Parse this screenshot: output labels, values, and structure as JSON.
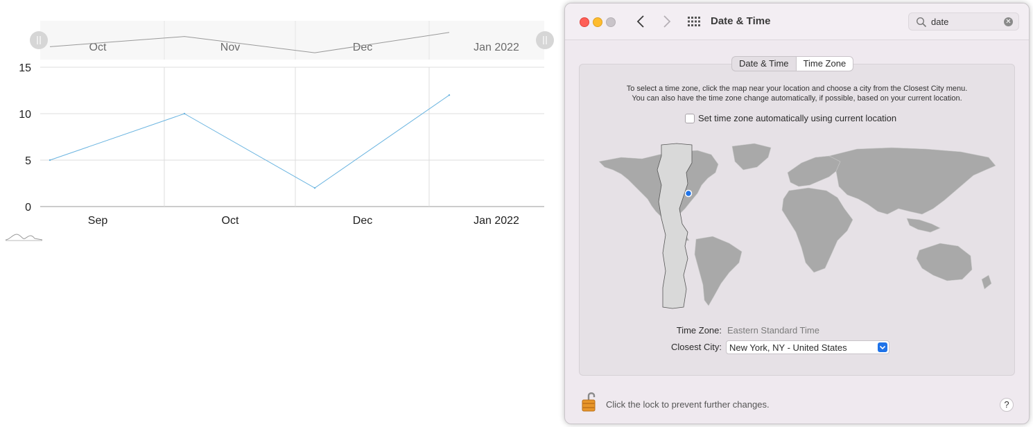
{
  "chart_data": {
    "type": "line",
    "x": [
      "Sep",
      "Oct",
      "Nov",
      "Dec",
      "Jan 2022"
    ],
    "values": [
      5,
      10,
      2,
      12
    ],
    "x_tick_labels": [
      "Sep",
      "Oct",
      "Dec",
      "Jan 2022"
    ],
    "navigator_tick_labels": [
      "Oct",
      "Nov",
      "Dec",
      "Jan 2022"
    ],
    "y_ticks": [
      "0",
      "5",
      "10",
      "15"
    ],
    "ylim": [
      0,
      15
    ],
    "grid": true,
    "line_color": "#6ab4e0"
  },
  "window": {
    "title": "Date & Time",
    "search_value": "date",
    "tabs": [
      {
        "label": "Date & Time",
        "selected": false
      },
      {
        "label": "Time Zone",
        "selected": true
      }
    ],
    "instructions_line1": "To select a time zone, click the map near your location and choose a city from the Closest City menu.",
    "instructions_line2": "You can also have the time zone change automatically, if possible, based on your current location.",
    "auto_timezone_label": "Set time zone automatically using current location",
    "auto_timezone_checked": false,
    "time_zone_label": "Time Zone:",
    "time_zone_value": "Eastern Standard Time",
    "closest_city_label": "Closest City:",
    "closest_city_value": "New York, NY - United States",
    "lock_text": "Click the lock to prevent further changes.",
    "help_label": "?",
    "icons": [
      "close-icon",
      "minimize-icon",
      "zoom-icon",
      "back-chevron-icon",
      "forward-chevron-icon",
      "grid-icon",
      "search-icon",
      "clear-icon",
      "lock-icon",
      "chevron-down-icon"
    ],
    "colors": {
      "accent": "#1f73e8",
      "map_land": "#a9a9a9",
      "selected_zone": "#d9d9d9"
    }
  }
}
